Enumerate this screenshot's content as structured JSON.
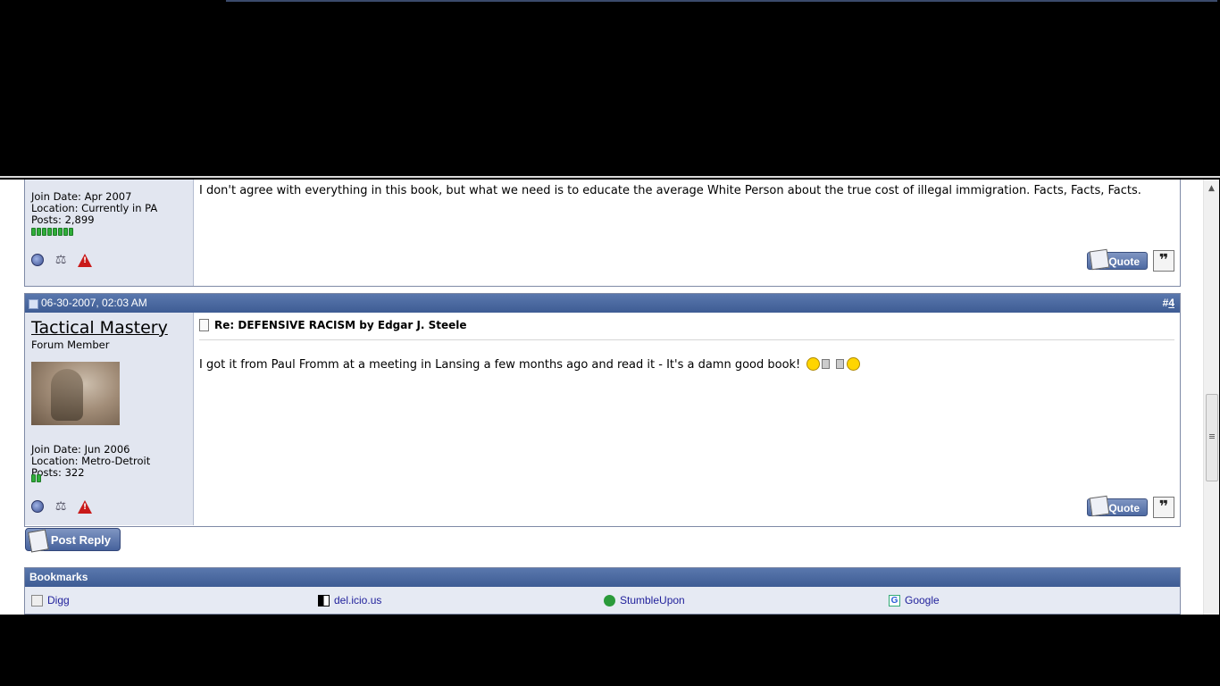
{
  "post3": {
    "join_date": "Join Date: Apr 2007",
    "location": "Location: Currently in PA",
    "posts": "Posts: 2,899",
    "reputation_pips": 8,
    "message": "I don't agree with everything in this book, but what we need is to educate the average White Person about the true cost of illegal immigration. Facts, Facts, Facts.",
    "quote_label": "Quote"
  },
  "post4": {
    "date": "06-30-2007, 02:03 AM",
    "number_prefix": "#",
    "number": "4",
    "username": "Tactical Mastery",
    "user_title": "Forum Member",
    "join_date": "Join Date: Jun 2006",
    "location": "Location: Metro-Detroit",
    "posts": "Posts: 322",
    "reputation_pips": 2,
    "title": "Re: DEFENSIVE RACISM by Edgar J. Steele",
    "message": "I got it from Paul Fromm at a meeting in Lansing a few months ago and read it - It's a damn good book!",
    "quote_label": "Quote"
  },
  "post_reply_label": "Post Reply",
  "bookmarks": {
    "title": "Bookmarks",
    "items": [
      "Digg",
      "del.icio.us",
      "StumbleUpon",
      "Google"
    ]
  },
  "icons": {
    "online_status": "online-status-icon",
    "reputation": "reputation-scale-icon",
    "report": "report-post-icon",
    "multiquote": "multiquote-icon"
  },
  "colors": {
    "header_blue": "#3e5c94",
    "sidebar_bg": "#e2e6f0",
    "link": "#22229c",
    "reputation_green": "#2fae3a"
  }
}
